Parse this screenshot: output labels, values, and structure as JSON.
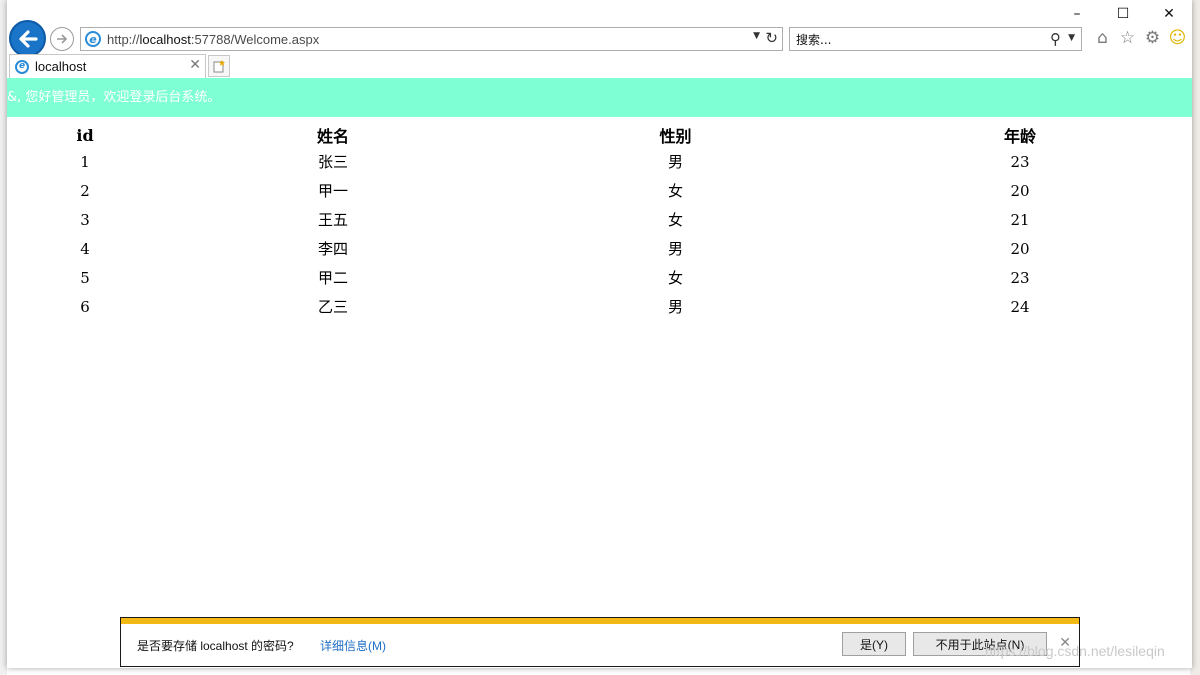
{
  "browser": {
    "address": {
      "prefix": "http://",
      "host": "localhost",
      "rest": ":57788/Welcome.aspx"
    },
    "search": {
      "placeholder": "搜索..."
    },
    "tab": {
      "label": "localhost"
    },
    "caption": {
      "minimize": "–",
      "maximize": "☐",
      "close": "✕"
    }
  },
  "banner": {
    "text": "&, 您好管理员，欢迎登录后台系统。"
  },
  "table": {
    "headers": [
      "id",
      "姓名",
      "性别",
      "年龄"
    ],
    "rows": [
      [
        "1",
        "张三",
        "男",
        "23"
      ],
      [
        "2",
        "甲一",
        "女",
        "20"
      ],
      [
        "3",
        "王五",
        "女",
        "21"
      ],
      [
        "4",
        "李四",
        "男",
        "20"
      ],
      [
        "5",
        "甲二",
        "女",
        "23"
      ],
      [
        "6",
        "乙三",
        "男",
        "24"
      ]
    ]
  },
  "notification": {
    "message": "是否要存储 localhost 的密码?",
    "details_link": "详细信息(M)",
    "yes_button": "是(Y)",
    "never_button": "不用于此站点(N)"
  },
  "watermark": "https://blog.csdn.net/lesileqin",
  "colors": {
    "banner_bg": "#7fffd4",
    "notify_bar": "#f2b915",
    "link": "#1f6fc5"
  }
}
